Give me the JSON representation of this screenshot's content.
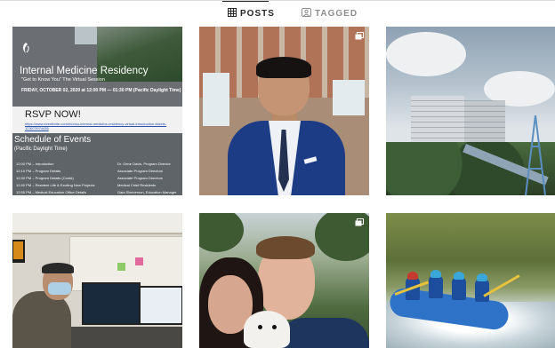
{
  "tabs": [
    {
      "label": "POSTS",
      "icon": "grid-icon",
      "active": true
    },
    {
      "label": "TAGGED",
      "icon": "tagged-icon",
      "active": false
    }
  ],
  "posts": [
    {
      "type": "flyer",
      "multi": false,
      "flyer": {
        "title": "Internal Medicine Residency",
        "subtitle": "\"Get to Know You\" The Virtual Session",
        "date": "FRIDAY, OCTOBER 02, 2020 at 12:00 PM — 01:30 PM (Pacific Daylight Time)",
        "rsvp": "RSVP NOW!",
        "rsvp_link": "https://www.eventbrite.com/e/uhsu-internal-medicine-residency-virtual-introduction-tickets-123073974435",
        "schedule_title": "Schedule of Events",
        "schedule_tz": "(Pacific Daylight Time)",
        "schedule": [
          {
            "time": "12:00 PM – Introduction",
            "who": "Dr. Gene Davis, Program Director"
          },
          {
            "time": "12:10 PM – Program Details",
            "who": "Associate Program Directors"
          },
          {
            "time": "12:30 PM – Program Details (Contd)",
            "who": "Associate Program Directors"
          },
          {
            "time": "12:40 PM – Resident Life & Exciting New Projects",
            "who": "Medical Chief Residents"
          },
          {
            "time": "12:55 PM – Medical Education Office Details",
            "who": "Gaia Slimberson, Education Manager"
          }
        ]
      }
    },
    {
      "type": "photo",
      "subject": "man in blue suit",
      "multi": true
    },
    {
      "type": "photo",
      "subject": "hospital building and bridge",
      "multi": false
    },
    {
      "type": "photo",
      "subject": "doctor at workstation",
      "multi": false
    },
    {
      "type": "photo",
      "subject": "selfie with dog",
      "multi": true
    },
    {
      "type": "photo",
      "subject": "whitewater rafting",
      "multi": false
    }
  ],
  "colors": {
    "text_active": "#262626",
    "text_inactive": "#8e8e8e",
    "divider": "#dbdbdb"
  }
}
